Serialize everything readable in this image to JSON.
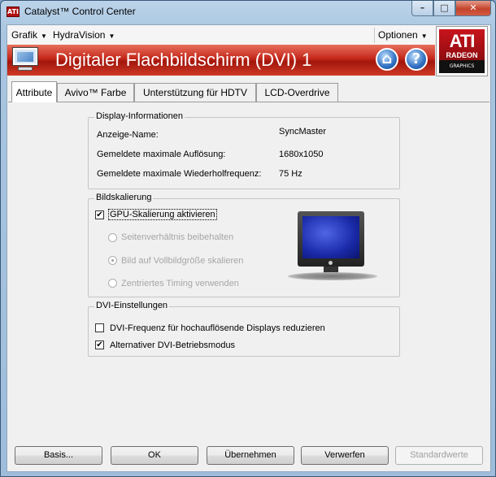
{
  "window": {
    "title": "Catalyst™ Control Center",
    "app_icon_text": "ATI",
    "controls": {
      "minimize": "–",
      "maximize": "□",
      "close": "✕"
    }
  },
  "menubar": {
    "items": [
      {
        "label": "Grafik"
      },
      {
        "label": "HydraVision"
      }
    ],
    "options_label": "Optionen",
    "dropdown_arrow": "▼"
  },
  "logo": {
    "brand": "ATI",
    "product": "RADEON",
    "tagline": "GRAPHICS"
  },
  "header": {
    "title": "Digitaler Flachbildschirm (DVI) 1",
    "home_icon": "⌂",
    "help_icon": "?"
  },
  "tabs": [
    {
      "label": "Attribute",
      "active": true
    },
    {
      "label": "Avivo™ Farbe",
      "active": false
    },
    {
      "label": "Unterstützung für HDTV",
      "active": false
    },
    {
      "label": "LCD-Overdrive",
      "active": false
    }
  ],
  "display_info": {
    "legend": "Display-Informationen",
    "rows": [
      {
        "label": "Anzeige-Name:",
        "value": "SyncMaster"
      },
      {
        "label": "Gemeldete maximale Auflösung:",
        "value": "1680x1050"
      },
      {
        "label": "Gemeldete maximale Wiederholfrequenz:",
        "value": "75 Hz"
      }
    ]
  },
  "scaling": {
    "legend": "Bildskalierung",
    "gpu_scaling": {
      "label": "GPU-Skalierung aktivieren",
      "checked": true
    },
    "options": [
      {
        "label": "Seitenverhältnis beibehalten",
        "selected": false
      },
      {
        "label": "Bild auf Vollbildgröße skalieren",
        "selected": true
      },
      {
        "label": "Zentriertes Timing verwenden",
        "selected": false
      }
    ]
  },
  "dvi": {
    "legend": "DVI-Einstellungen",
    "options": [
      {
        "label": "DVI-Frequenz für hochauflösende Displays reduzieren",
        "checked": false
      },
      {
        "label": "Alternativer DVI-Betriebsmodus",
        "checked": true
      }
    ]
  },
  "check_mark": "✔",
  "buttons": {
    "basis": "Basis...",
    "ok": "OK",
    "apply": "Übernehmen",
    "discard": "Verwerfen",
    "defaults": "Standardwerte"
  }
}
